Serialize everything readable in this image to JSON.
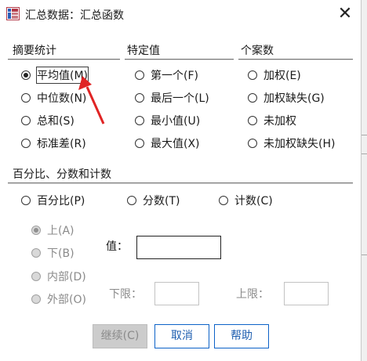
{
  "title": "汇总数据：汇总函数",
  "close_glyph": "✕",
  "summary_stats": {
    "heading": "摘要统计",
    "options": [
      {
        "label": "平均值(M)",
        "selected": true
      },
      {
        "label": "中位数(N)",
        "selected": false
      },
      {
        "label": "总和(S)",
        "selected": false
      },
      {
        "label": "标准差(R)",
        "selected": false
      }
    ]
  },
  "specific_values": {
    "heading": "特定值",
    "options": [
      {
        "label": "第一个(F)",
        "selected": false
      },
      {
        "label": "最后一个(L)",
        "selected": false
      },
      {
        "label": "最小值(U)",
        "selected": false
      },
      {
        "label": "最大值(X)",
        "selected": false
      }
    ]
  },
  "cases": {
    "heading": "个案数",
    "options": [
      {
        "label": "加权(E)",
        "selected": false
      },
      {
        "label": "加权缺失(G)",
        "selected": false
      },
      {
        "label": "未加权",
        "selected": false
      },
      {
        "label": "未加权缺失(H)",
        "selected": false
      }
    ]
  },
  "percent_section": {
    "heading": "百分比、分数和计数",
    "options": [
      {
        "label": "百分比(P)",
        "selected": false
      },
      {
        "label": "分数(T)",
        "selected": false
      },
      {
        "label": "计数(C)",
        "selected": false
      }
    ],
    "range_options": [
      {
        "label": "上(A)",
        "selected": true,
        "enabled": false
      },
      {
        "label": "下(B)",
        "selected": false,
        "enabled": false
      },
      {
        "label": "内部(D)",
        "selected": false,
        "enabled": false
      },
      {
        "label": "外部(O)",
        "selected": false,
        "enabled": false
      }
    ],
    "value_label": "值：",
    "value": "",
    "lower_label": "下限：",
    "lower_value": "",
    "upper_label": "上限：",
    "upper_value": ""
  },
  "buttons": {
    "continue": "继续(C)",
    "cancel": "取消",
    "help": "帮助"
  },
  "colors": {
    "accent": "#0c62c8",
    "annotation_arrow": "#e02424",
    "disabled_button": "#cccccc"
  }
}
